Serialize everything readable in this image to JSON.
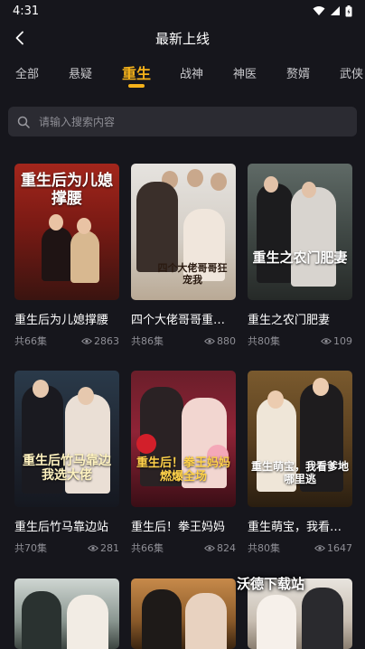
{
  "status_bar": {
    "time": "4:31"
  },
  "header": {
    "title": "最新上线"
  },
  "tabs": [
    {
      "label": "全部",
      "active": false
    },
    {
      "label": "悬疑",
      "active": false
    },
    {
      "label": "重生",
      "active": true
    },
    {
      "label": "战神",
      "active": false
    },
    {
      "label": "神医",
      "active": false
    },
    {
      "label": "赘婿",
      "active": false
    },
    {
      "label": "武侠",
      "active": false
    }
  ],
  "search": {
    "placeholder": "请输入搜索内容"
  },
  "colors": {
    "accent": "#f5b21a",
    "background": "#16161c",
    "search_bg": "#2b2b32"
  },
  "dramas": [
    {
      "title": "重生后为儿媳撑腰",
      "episodes": "共66集",
      "views": "2863",
      "cover_text": "重生后为儿媳撑腰"
    },
    {
      "title": "四个大佬哥哥重宠我",
      "episodes": "共86集",
      "views": "880",
      "cover_text": "四个大佬哥哥狂宠我"
    },
    {
      "title": "重生之农门肥妻",
      "episodes": "共80集",
      "views": "109",
      "cover_text": "重生之农门肥妻"
    },
    {
      "title": "重生后竹马靠边站",
      "episodes": "共70集",
      "views": "281",
      "cover_text": "重生后竹马靠边我选大佬"
    },
    {
      "title": "重生后！拳王妈妈",
      "episodes": "共66集",
      "views": "824",
      "cover_text": "重生后！拳王妈妈 燃爆全场"
    },
    {
      "title": "重生萌宝，我看谁敢",
      "episodes": "共80集",
      "views": "1647",
      "cover_text": "重生萌宝，我看爹地哪里逃"
    }
  ],
  "watermark": "沃德下载站"
}
